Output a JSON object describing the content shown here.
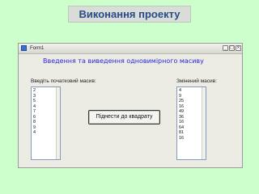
{
  "slide": {
    "title": "Виконання проекту"
  },
  "window": {
    "title": "Form1",
    "minimize_glyph": "_",
    "maximize_glyph": "□",
    "close_glyph": "×"
  },
  "form": {
    "heading": "Введення та виведення одновимірного масиву",
    "input_label": "Введіть початковий масив:",
    "output_label": "Змінений масив:",
    "input_values": [
      "2",
      "3",
      "5",
      "4",
      "7",
      "6",
      "8",
      "9",
      "4"
    ],
    "output_values": [
      "4",
      "9",
      "25",
      "16",
      "49",
      "36",
      "16",
      "64",
      "81",
      "16"
    ],
    "button_label": "Піднести до квадрату"
  },
  "colors": {
    "slide_background": "#ccffcc",
    "heading_text": "#2a2ad8",
    "title_text": "#2b4a8a"
  }
}
